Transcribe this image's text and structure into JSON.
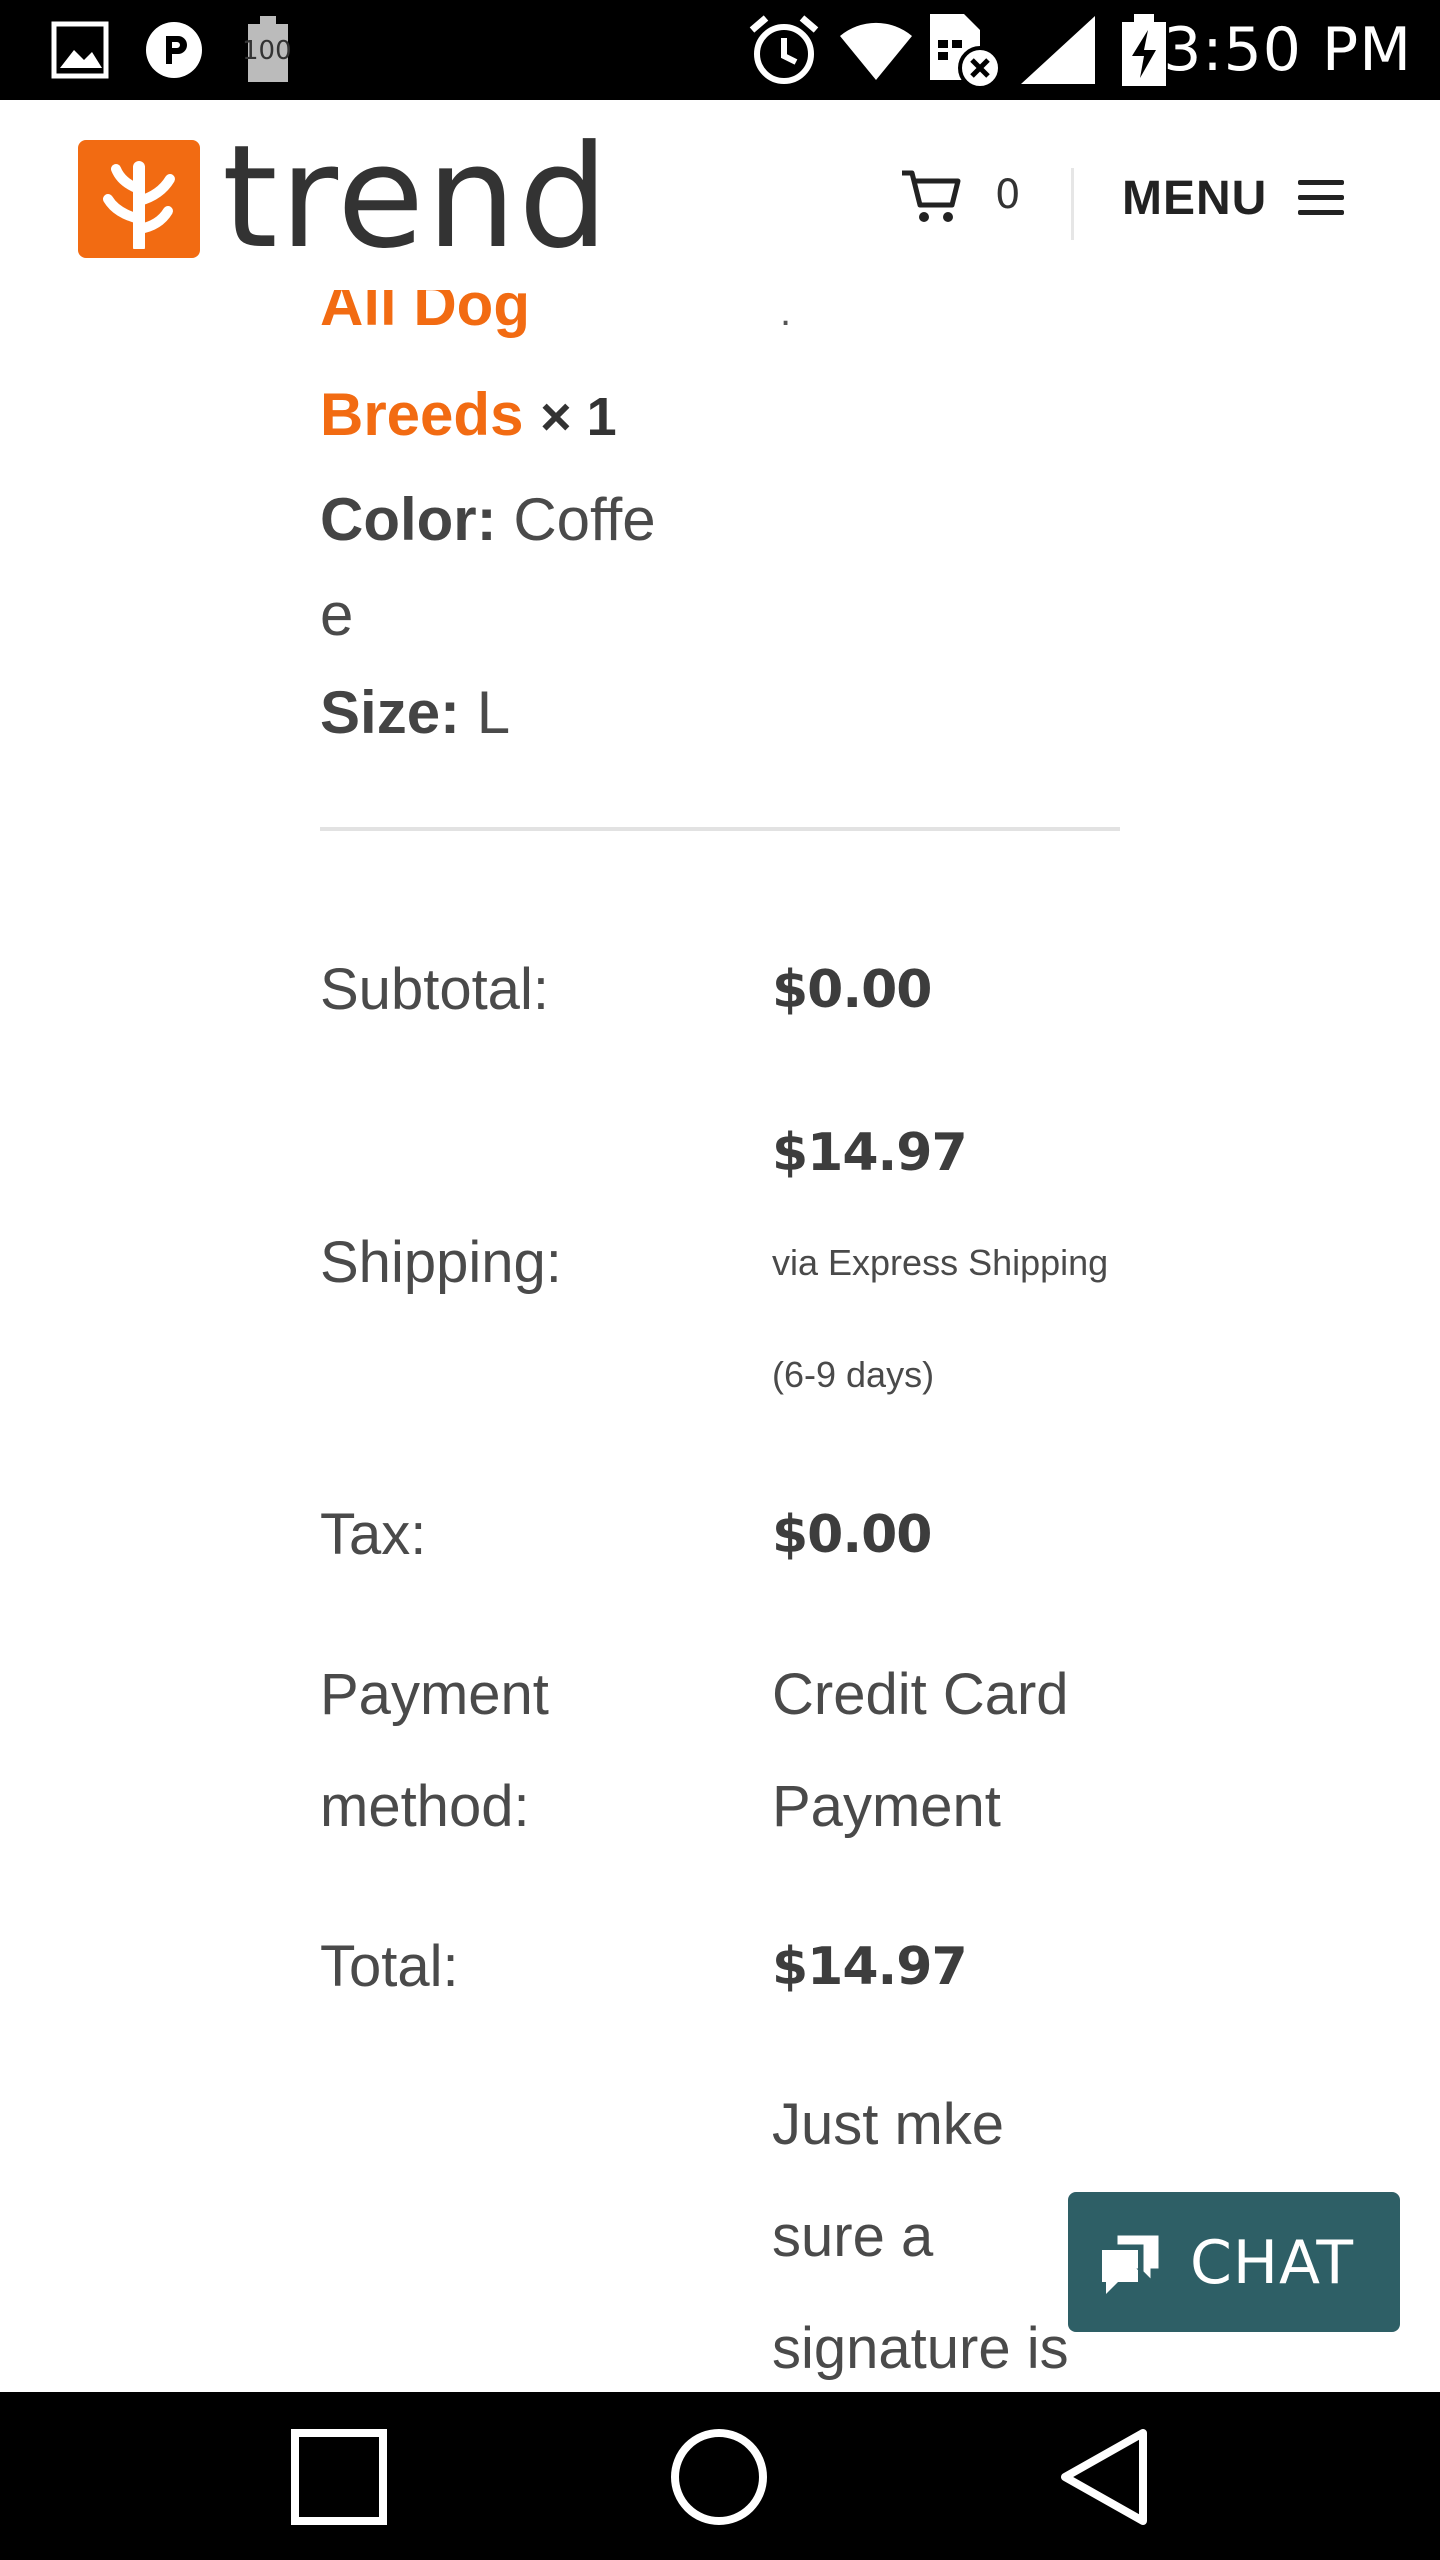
{
  "status_bar": {
    "time": "3:50 PM",
    "battery_label": "100",
    "icons": [
      "gallery-icon",
      "p-app-icon",
      "battery-saver-icon",
      "alarm-icon",
      "wifi-icon",
      "sim-disabled-icon",
      "signal-icon",
      "battery-charging-icon"
    ]
  },
  "header": {
    "logo_text": "trend",
    "cart_count": "0",
    "menu_label": "MENU"
  },
  "order_item": {
    "name_line1": "All Dog",
    "name_line2": "Breeds",
    "quantity": "× 1",
    "color_label": "Color:",
    "color_value_line1": "Coffe",
    "color_value_line2": "e",
    "size_label": "Size:",
    "size_value": "L",
    "stray_mark": "."
  },
  "totals": {
    "subtotal_label": "Subtotal:",
    "subtotal_value": "$0.00",
    "shipping_label": "Shipping:",
    "shipping_value": "$14.97",
    "shipping_method": "via Express Shipping",
    "shipping_time": "(6-9 days)",
    "tax_label": "Tax:",
    "tax_value": "$0.00",
    "payment_label_line1": "Payment",
    "payment_label_line2": "method:",
    "payment_value_line1": "Credit Card",
    "payment_value_line2": "Payment",
    "total_label": "Total:",
    "total_value": "$14.97",
    "note_line1": "Just mke",
    "note_line2": "sure a",
    "note_line3": "signature is"
  },
  "chat": {
    "label": "CHAT"
  },
  "colors": {
    "brand_orange": "#f26b12",
    "chat_teal": "#2e5f66",
    "text": "#4a4a4a"
  }
}
